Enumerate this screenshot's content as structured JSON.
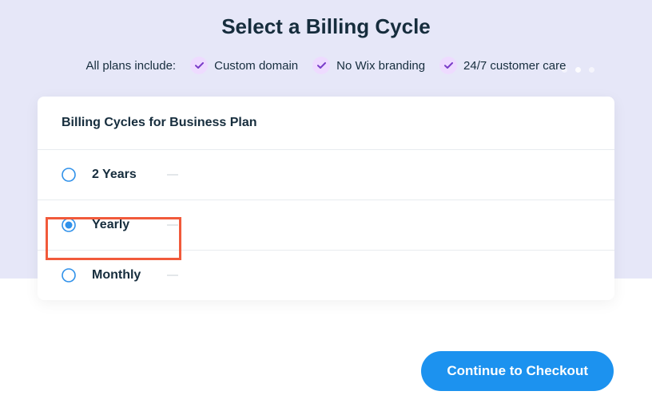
{
  "header": {
    "title": "Select a Billing Cycle",
    "intro": "All plans include:",
    "features": [
      "Custom domain",
      "No Wix branding",
      "24/7 customer care"
    ]
  },
  "card": {
    "title": "Billing Cycles for Business Plan",
    "options": [
      {
        "label": "2 Years",
        "selected": false
      },
      {
        "label": "Yearly",
        "selected": true
      },
      {
        "label": "Monthly",
        "selected": false
      }
    ]
  },
  "cta": {
    "label": "Continue to Checkout"
  }
}
